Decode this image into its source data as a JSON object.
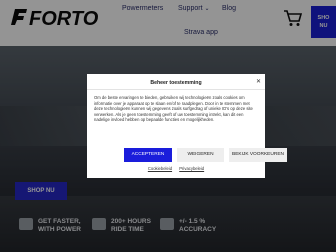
{
  "brand": {
    "name": "FORTO"
  },
  "nav": {
    "items": [
      "Powermeters",
      "Support",
      "Blog"
    ],
    "strava": "Strava app",
    "shop_top": [
      "SHO",
      "NU"
    ]
  },
  "hero": {
    "shop_button": "SHOP NU",
    "features": [
      {
        "text": "GET FASTER,\nWITH POWER",
        "icon": "bolt-icon"
      },
      {
        "text": "200+ HOURS\nRIDE TIME",
        "icon": "battery-icon"
      },
      {
        "text": "+/- 1.5 %\nACCURACY",
        "icon": "target-icon"
      }
    ]
  },
  "consent": {
    "title": "Beheer toestemming",
    "body": "Om de beste ervaringen te bieden, gebruiken wij technologieën zoals cookies om informatie over je apparaat op te slaan en/of te raadplegen. Door in te stemmen met deze technologieën kunnen wij gegevens zoals surfgedrag of unieke ID's op deze site verwerken. Als je geen toestemming geeft of uw toestemming intrekt, kan dit een nadelige invloed hebben op bepaalde functies en mogelijkheden.",
    "accept": "ACCEPTEREN",
    "refuse": "WEIGEREN",
    "preferences": "BEKIJK VOORKEUREN",
    "links": [
      "Cookiebeleid",
      "Privacybeleid"
    ]
  },
  "colors": {
    "accent": "#1a1ddb",
    "nav_text": "#2a2e6a"
  }
}
